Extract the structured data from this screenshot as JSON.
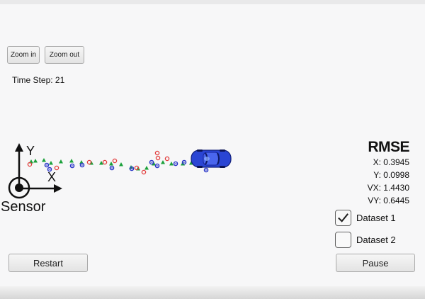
{
  "toolbar": {
    "zoom_in_label": "Zoom in",
    "zoom_out_label": "Zoom out"
  },
  "status": {
    "time_step": "Time Step: 21"
  },
  "axes": {
    "y_label": "Y",
    "x_label": "X",
    "sensor_label": "Sensor"
  },
  "rmse": {
    "title": "RMSE",
    "x": "X: 0.3945",
    "y": "Y: 0.0998",
    "vx": "VX: 1.4430",
    "vy": "VY: 0.6445"
  },
  "datasets": [
    {
      "label": "Dataset 1",
      "checked": true
    },
    {
      "label": "Dataset 2",
      "checked": false
    }
  ],
  "controls": {
    "restart_label": "Restart",
    "pause_label": "Pause"
  },
  "colors": {
    "estimate_marker": "#1aa03a",
    "lidar_marker": "#e23b3b",
    "radar_marker": "#2b38c8",
    "car_body": "#2a45d4"
  }
}
